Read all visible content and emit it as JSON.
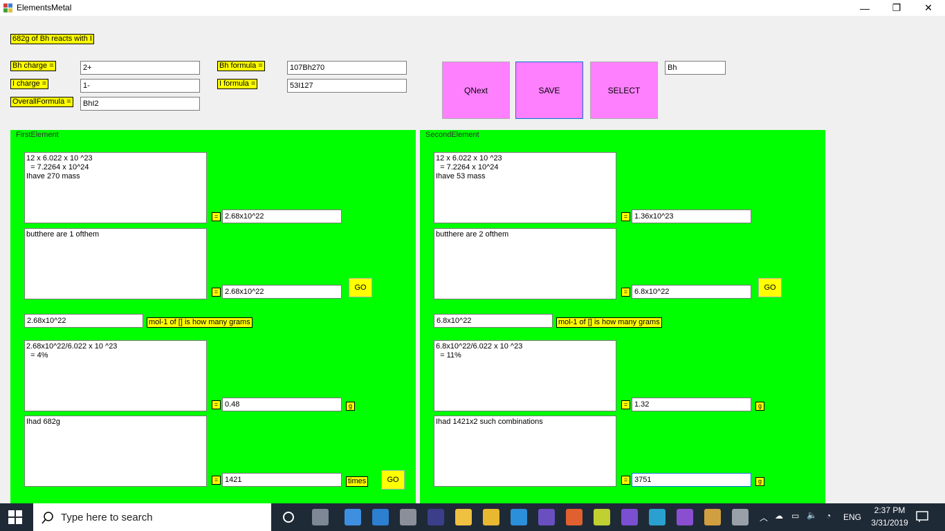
{
  "window": {
    "title": "ElementsMetal",
    "minimize": "—",
    "restore": "❐",
    "close": "✕"
  },
  "header": {
    "reaction": "682g of Bh reacts with I"
  },
  "fields": {
    "bh_charge_label": "Bh charge =",
    "bh_charge_value": "2+",
    "i_charge_label": "I charge =",
    "i_charge_value": "1-",
    "overall_label": "OverallFormula =",
    "overall_value": "BhI2",
    "bh_formula_label": "Bh formula =",
    "bh_formula_value": "107Bh270",
    "i_formula_label": "I formula =",
    "i_formula_value": "53I127",
    "select_value": "Bh"
  },
  "buttons": {
    "qnext": "QNext",
    "save": "SAVE",
    "select": "SELECT",
    "go": "GO"
  },
  "first": {
    "title": "FirstElement",
    "area1": "12 x 6.022 x 10 ^23\n  = 7.2264 x 10^24\nIhave 270 mass",
    "eq": "=",
    "res1": "2.68x10^22",
    "area2": "butthere are 1 ofthem",
    "res2": "2.68x10^22",
    "mol_value": "2.68x10^22",
    "mol_label": "mol-1 of [] is how many grams",
    "area3": "2.68x10^22/6.022 x 10 ^23\n  = 4%",
    "res3": "0.48",
    "unit_g": "g",
    "area4": "Ihad 682g",
    "res4": "1421",
    "unit_times": "times"
  },
  "second": {
    "title": "SecondElement",
    "area1": "12 x 6.022 x 10 ^23\n  = 7.2264 x 10^24\nIhave 53 mass",
    "res1": "1.36x10^23",
    "area2": "butthere are 2 ofthem",
    "res2": "6.8x10^22",
    "mol_value": "6.8x10^22",
    "mol_label": "mol-1 of [] is how many grams",
    "area3": "6.8x10^22/6.022 x 10 ^23\n  = 11%",
    "res3": "1.32",
    "unit_g": "g",
    "area4": "Ihad 1421x2 such combinations",
    "res4": "3751",
    "unit_g2": "g"
  },
  "taskbar": {
    "search_placeholder": "Type here to search",
    "lang": "ENG",
    "time": "2:37 PM",
    "date": "3/31/2019",
    "app_icons": [
      "task-view-icon",
      "file-explorer-icon",
      "edge-icon",
      "notepad-icon",
      "eclipse-icon",
      "python-icon",
      "folder-icon",
      "qq-icon",
      "anaconda-icon",
      "app-icon",
      "app2-icon",
      "anaconda2-icon",
      "winforms-app-icon",
      "visual-studio-icon",
      "paint-icon",
      "calculator-icon"
    ],
    "colors": {
      "taskbar": "#1f2a37",
      "accent": "#00ff00",
      "label": "#ffff00",
      "pink": "#ff80ff"
    }
  }
}
